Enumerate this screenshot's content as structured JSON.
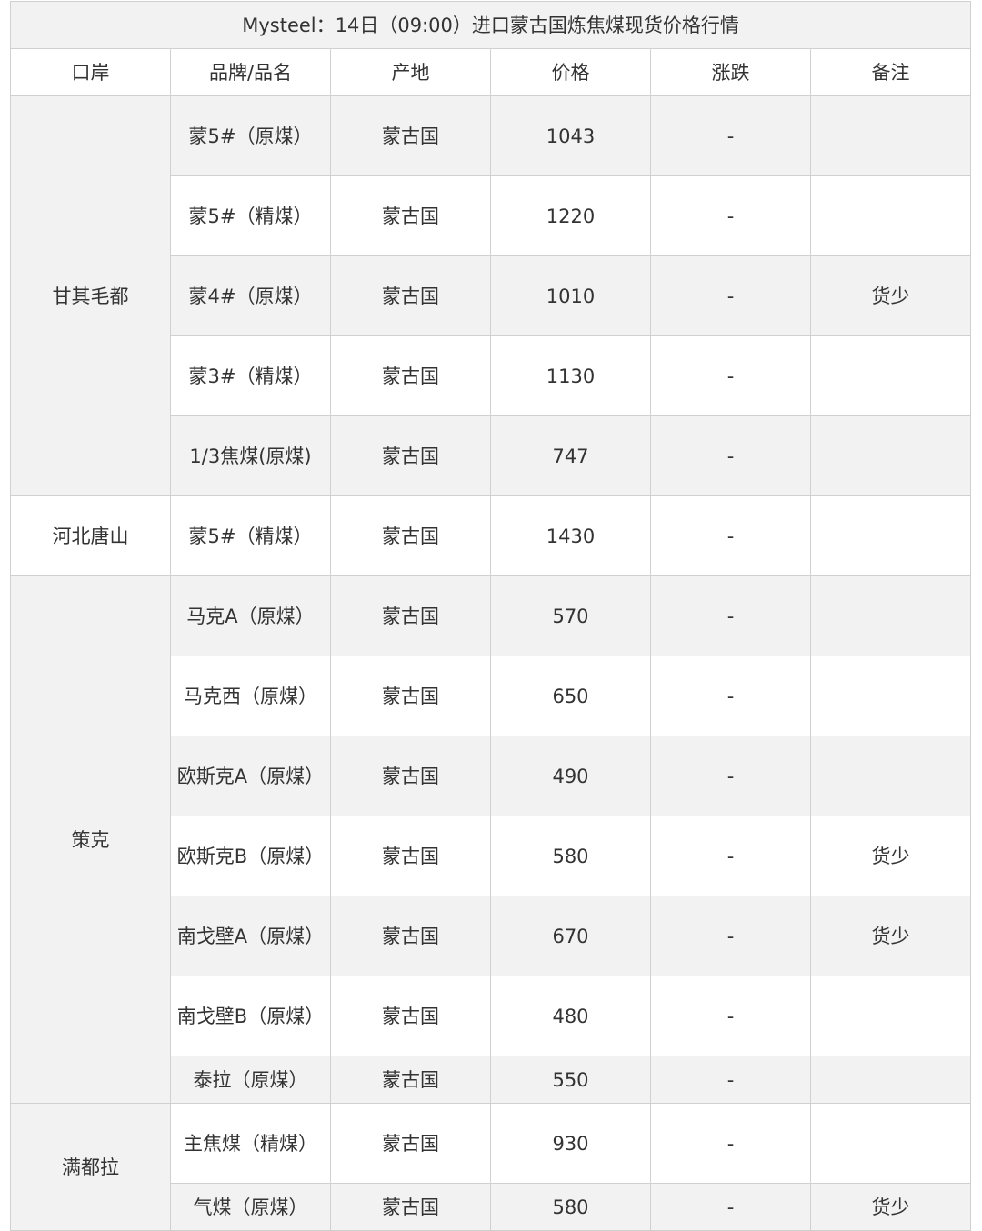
{
  "table": {
    "title": "Mysteel：14日（09:00）进口蒙古国炼焦煤现货价格行情",
    "headers": [
      "口岸",
      "品牌/品名",
      "产地",
      "价格",
      "涨跌",
      "备注"
    ],
    "groups": [
      {
        "port": "甘其毛都",
        "rows": [
          {
            "brand": "蒙5#（原煤）",
            "origin": "蒙古国",
            "price": "1043",
            "change": "-",
            "note": ""
          },
          {
            "brand": "蒙5#（精煤）",
            "origin": "蒙古国",
            "price": "1220",
            "change": "-",
            "note": ""
          },
          {
            "brand": "蒙4#（原煤）",
            "origin": "蒙古国",
            "price": "1010",
            "change": "-",
            "note": "货少"
          },
          {
            "brand": "蒙3#（精煤）",
            "origin": "蒙古国",
            "price": "1130",
            "change": "-",
            "note": ""
          },
          {
            "brand": "1/3焦煤(原煤)",
            "origin": "蒙古国",
            "price": "747",
            "change": "-",
            "note": ""
          }
        ]
      },
      {
        "port": "河北唐山",
        "rows": [
          {
            "brand": "蒙5#（精煤）",
            "origin": "蒙古国",
            "price": "1430",
            "change": "-",
            "note": ""
          }
        ]
      },
      {
        "port": "策克",
        "rows": [
          {
            "brand": "马克A（原煤）",
            "origin": "蒙古国",
            "price": "570",
            "change": "-",
            "note": ""
          },
          {
            "brand": "马克西（原煤）",
            "origin": "蒙古国",
            "price": "650",
            "change": "-",
            "note": ""
          },
          {
            "brand": "欧斯克A（原煤）",
            "origin": "蒙古国",
            "price": "490",
            "change": "-",
            "note": ""
          },
          {
            "brand": "欧斯克B（原煤）",
            "origin": "蒙古国",
            "price": "580",
            "change": "-",
            "note": "货少"
          },
          {
            "brand": "南戈壁A（原煤）",
            "origin": "蒙古国",
            "price": "670",
            "change": "-",
            "note": "货少"
          },
          {
            "brand": "南戈壁B（原煤）",
            "origin": "蒙古国",
            "price": "480",
            "change": "-",
            "note": ""
          },
          {
            "brand": "泰拉（原煤）",
            "origin": "蒙古国",
            "price": "550",
            "change": "-",
            "note": ""
          }
        ]
      },
      {
        "port": "满都拉",
        "rows": [
          {
            "brand": "主焦煤（精煤）",
            "origin": "蒙古国",
            "price": "930",
            "change": "-",
            "note": ""
          },
          {
            "brand": "气煤（原煤）",
            "origin": "蒙古国",
            "price": "580",
            "change": "-",
            "note": "货少"
          }
        ]
      }
    ]
  }
}
